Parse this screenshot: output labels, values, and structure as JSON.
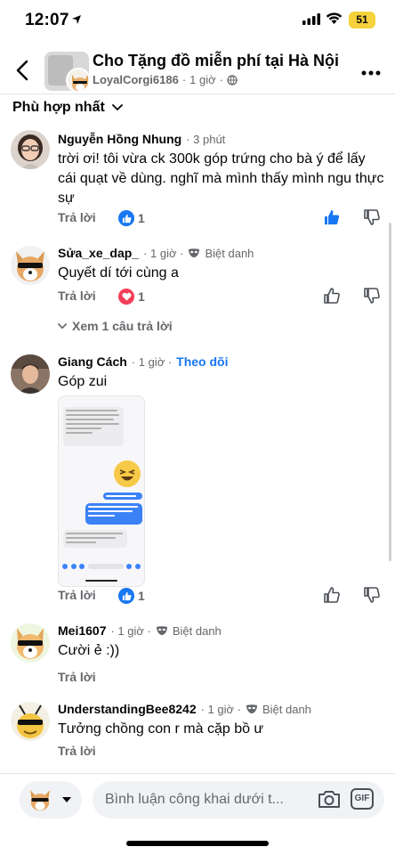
{
  "status_bar": {
    "time": "12:07",
    "battery": "51"
  },
  "header": {
    "title": "Cho Tặng đồ miễn phí tại Hà Nội",
    "author": "LoyalCorgi6186",
    "time": "1 giờ",
    "separator": "·"
  },
  "sort": {
    "label": "Phù hợp nhất"
  },
  "comments": [
    {
      "name": "Nguyễn Hồng Nhung",
      "meta": "· 3 phút",
      "text": "trời ơi! tôi vừa ck 300k góp trứng cho bà ý để lấy cái quạt về dùng. nghĩ mà mình thấy mình ngu thực sự",
      "reply_label": "Trả lời",
      "reaction_count": "1",
      "reaction_type": "like",
      "liked": true
    },
    {
      "name": "Sửa_xe_dap_",
      "meta": "· 1 giờ ·",
      "nickname_label": "Biệt danh",
      "text": "Quyết dí tới cùng a",
      "reply_label": "Trả lời",
      "reaction_count": "1",
      "reaction_type": "love",
      "view_replies": "Xem 1 câu trả lời"
    },
    {
      "name": "Giang Cách",
      "meta": "· 1 giờ ·",
      "follow_label": "Theo dõi",
      "text": "Góp zui",
      "reply_label": "Trả lời",
      "reaction_count": "1",
      "reaction_type": "like"
    },
    {
      "name": "Mei1607",
      "meta": "· 1 giờ ·",
      "nickname_label": "Biệt danh",
      "text": "Cười ẻ :))",
      "reply_label": "Trả lời"
    },
    {
      "name": "UnderstandingBee8242",
      "meta": "· 1 giờ ·",
      "nickname_label": "Biệt danh",
      "text": "Tưởng chồng con r mà cặp bồ ư",
      "reply_label": "Trả lời"
    }
  ],
  "composer": {
    "placeholder": "Bình luận công khai dưới t..."
  },
  "colors": {
    "accent": "#1877f2",
    "love": "#f33e58",
    "secondary_text": "#65676b"
  },
  "icons": [
    "back-icon",
    "more-icon",
    "chevron-down-icon",
    "like-icon",
    "dislike-icon",
    "love-icon",
    "mask-icon",
    "camera-icon",
    "gif-icon"
  ]
}
